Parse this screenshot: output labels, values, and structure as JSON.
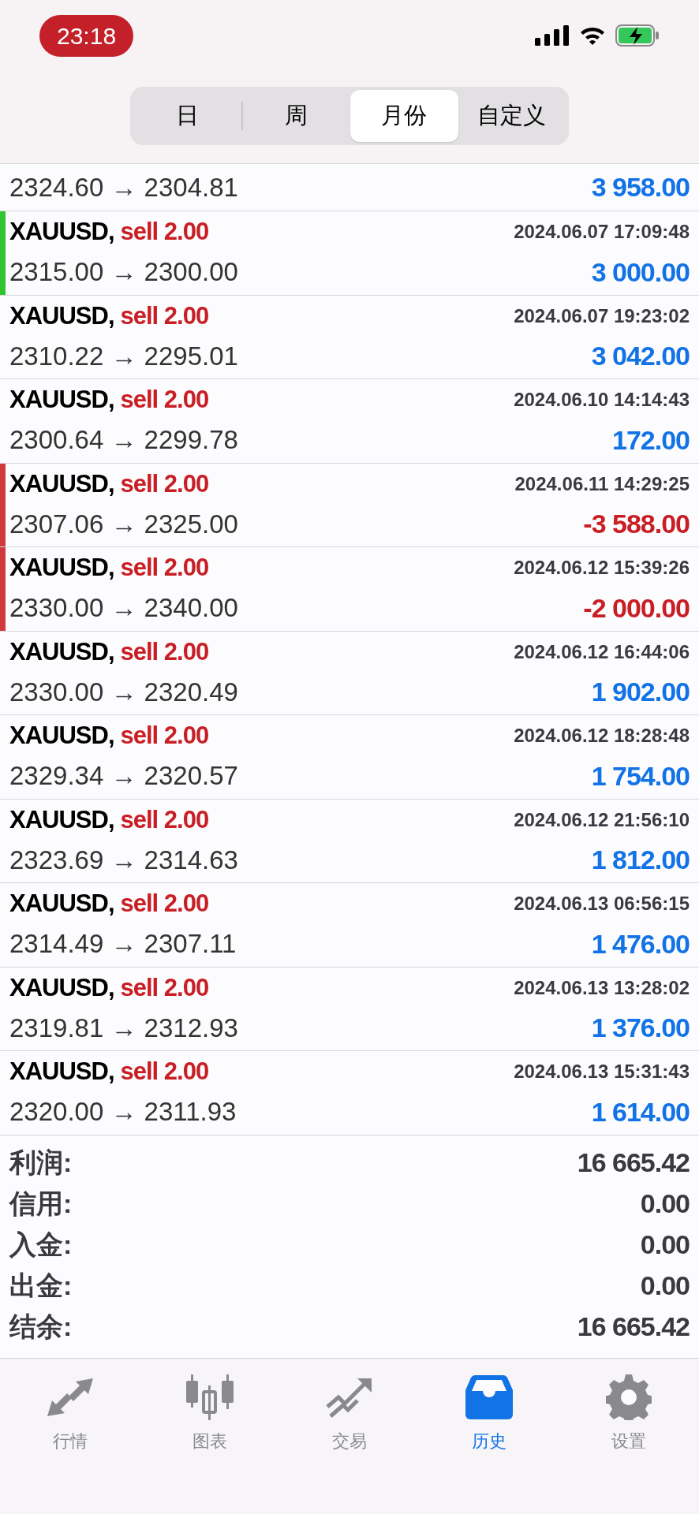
{
  "status_bar": {
    "time": "23:18"
  },
  "period_tabs": [
    {
      "label": "日",
      "selected": false
    },
    {
      "label": "周",
      "selected": false
    },
    {
      "label": "月份",
      "selected": true
    },
    {
      "label": "自定义",
      "selected": false
    }
  ],
  "partial_row": {
    "prices": "2324.60 → 2304.81",
    "profit": "3 958.00",
    "loss": false
  },
  "deals": [
    {
      "symbol": "XAUUSD,",
      "side": "sell 2.00",
      "time": "2024.06.07 17:09:48",
      "prices": "2315.00 → 2300.00",
      "profit": "3 000.00",
      "loss": false,
      "color": "#2ec52e"
    },
    {
      "symbol": "XAUUSD,",
      "side": "sell 2.00",
      "time": "2024.06.07 19:23:02",
      "prices": "2310.22 → 2295.01",
      "profit": "3 042.00",
      "loss": false
    },
    {
      "symbol": "XAUUSD,",
      "side": "sell 2.00",
      "time": "2024.06.10 14:14:43",
      "prices": "2300.64 → 2299.78",
      "profit": "172.00",
      "loss": false
    },
    {
      "symbol": "XAUUSD,",
      "side": "sell 2.00",
      "time": "2024.06.11 14:29:25",
      "prices": "2307.06 → 2325.00",
      "profit": "-3 588.00",
      "loss": true,
      "color": "#d0393e"
    },
    {
      "symbol": "XAUUSD,",
      "side": "sell 2.00",
      "time": "2024.06.12 15:39:26",
      "prices": "2330.00 → 2340.00",
      "profit": "-2 000.00",
      "loss": true,
      "color": "#d0393e"
    },
    {
      "symbol": "XAUUSD,",
      "side": "sell 2.00",
      "time": "2024.06.12 16:44:06",
      "prices": "2330.00 → 2320.49",
      "profit": "1 902.00",
      "loss": false
    },
    {
      "symbol": "XAUUSD,",
      "side": "sell 2.00",
      "time": "2024.06.12 18:28:48",
      "prices": "2329.34 → 2320.57",
      "profit": "1 754.00",
      "loss": false
    },
    {
      "symbol": "XAUUSD,",
      "side": "sell 2.00",
      "time": "2024.06.12 21:56:10",
      "prices": "2323.69 → 2314.63",
      "profit": "1 812.00",
      "loss": false
    },
    {
      "symbol": "XAUUSD,",
      "side": "sell 2.00",
      "time": "2024.06.13 06:56:15",
      "prices": "2314.49 → 2307.11",
      "profit": "1 476.00",
      "loss": false
    },
    {
      "symbol": "XAUUSD,",
      "side": "sell 2.00",
      "time": "2024.06.13 13:28:02",
      "prices": "2319.81 → 2312.93",
      "profit": "1 376.00",
      "loss": false
    },
    {
      "symbol": "XAUUSD,",
      "side": "sell 2.00",
      "time": "2024.06.13 15:31:43",
      "prices": "2320.00 → 2311.93",
      "profit": "1 614.00",
      "loss": false
    }
  ],
  "summary": [
    {
      "label": "利润:",
      "value": "16 665.42"
    },
    {
      "label": "信用:",
      "value": "0.00"
    },
    {
      "label": "入金:",
      "value": "0.00"
    },
    {
      "label": "出金:",
      "value": "0.00"
    },
    {
      "label": "结余:",
      "value": "16 665.42"
    }
  ],
  "tab_bar": [
    {
      "kind": "quotes",
      "label": "行情",
      "selected": false
    },
    {
      "kind": "chart",
      "label": "图表",
      "selected": false
    },
    {
      "kind": "trade",
      "label": "交易",
      "selected": false
    },
    {
      "kind": "history",
      "label": "历史",
      "selected": true
    },
    {
      "kind": "settings",
      "label": "设置",
      "selected": false
    }
  ]
}
